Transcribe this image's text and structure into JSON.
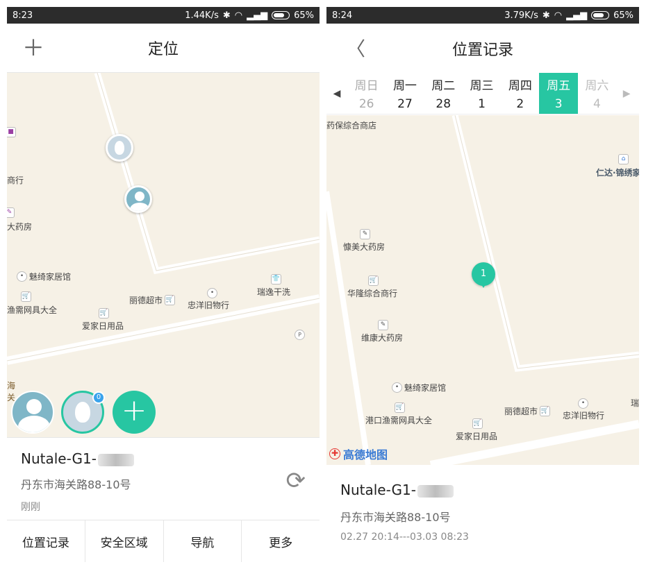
{
  "left": {
    "status": {
      "time": "8:23",
      "speed": "1.44K/s",
      "battery": "65%"
    },
    "title": "定位",
    "map_labels": [
      {
        "text": "商行"
      },
      {
        "text": "大药房"
      },
      {
        "text": "魅绮家居馆"
      },
      {
        "text": "渔需网具大全"
      },
      {
        "text": "丽德超市"
      },
      {
        "text": "忠洋旧物行"
      },
      {
        "text": "瑞逸干洗"
      },
      {
        "text": "爱家日用品"
      },
      {
        "text": "海关"
      }
    ],
    "device": {
      "name": "Nutale-G1-",
      "badge": "0",
      "address": "丹东市海关路88-10号",
      "time": "刚刚"
    },
    "tabs": [
      "位置记录",
      "安全区域",
      "导航",
      "更多"
    ]
  },
  "right": {
    "status": {
      "time": "8:24",
      "speed": "3.79K/s",
      "battery": "65%"
    },
    "title": "位置记录",
    "days": [
      {
        "weekday": "周日",
        "date": "26",
        "state": "past"
      },
      {
        "weekday": "周一",
        "date": "27",
        "state": "normal"
      },
      {
        "weekday": "周二",
        "date": "28",
        "state": "normal"
      },
      {
        "weekday": "周三",
        "date": "1",
        "state": "normal"
      },
      {
        "weekday": "周四",
        "date": "2",
        "state": "normal"
      },
      {
        "weekday": "周五",
        "date": "3",
        "state": "selected"
      },
      {
        "weekday": "周六",
        "date": "4",
        "state": "future"
      }
    ],
    "map_labels": [
      {
        "text": "药保综合商店"
      },
      {
        "text": "仁达·锦绣家"
      },
      {
        "text": "慷美大药房"
      },
      {
        "text": "华隆综合商行"
      },
      {
        "text": "维康大药房"
      },
      {
        "text": "魅绮家居馆"
      },
      {
        "text": "港口渔需网具大全"
      },
      {
        "text": "丽德超市"
      },
      {
        "text": "忠洋旧物行"
      },
      {
        "text": "爱家日用品"
      },
      {
        "text": "瑞"
      }
    ],
    "cluster_count": "1",
    "map_brand": "高德地图",
    "device": {
      "name": "Nutale-G1-",
      "address": "丹东市海关路88-10号",
      "range": "02.27 20:14---03.03 08:23"
    }
  },
  "colors": {
    "accent": "#27c6a2",
    "map_bg": "#f6f1e6",
    "badge": "#3aa3ec"
  }
}
